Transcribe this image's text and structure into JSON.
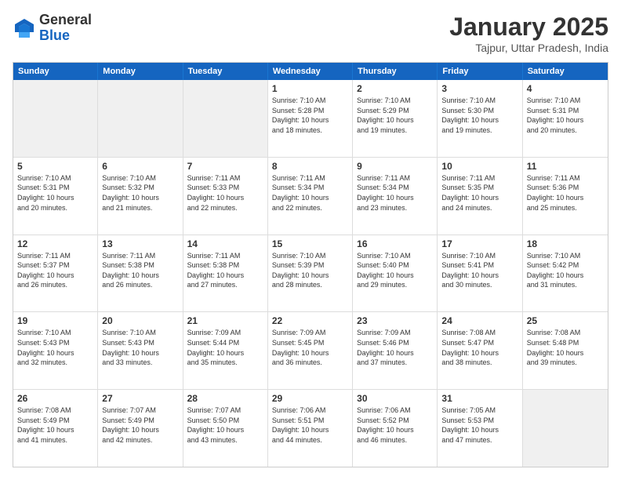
{
  "logo": {
    "general": "General",
    "blue": "Blue"
  },
  "title": "January 2025",
  "location": "Tajpur, Uttar Pradesh, India",
  "days_of_week": [
    "Sunday",
    "Monday",
    "Tuesday",
    "Wednesday",
    "Thursday",
    "Friday",
    "Saturday"
  ],
  "weeks": [
    [
      {
        "day": "",
        "info": ""
      },
      {
        "day": "",
        "info": ""
      },
      {
        "day": "",
        "info": ""
      },
      {
        "day": "1",
        "info": "Sunrise: 7:10 AM\nSunset: 5:28 PM\nDaylight: 10 hours\nand 18 minutes."
      },
      {
        "day": "2",
        "info": "Sunrise: 7:10 AM\nSunset: 5:29 PM\nDaylight: 10 hours\nand 19 minutes."
      },
      {
        "day": "3",
        "info": "Sunrise: 7:10 AM\nSunset: 5:30 PM\nDaylight: 10 hours\nand 19 minutes."
      },
      {
        "day": "4",
        "info": "Sunrise: 7:10 AM\nSunset: 5:31 PM\nDaylight: 10 hours\nand 20 minutes."
      }
    ],
    [
      {
        "day": "5",
        "info": "Sunrise: 7:10 AM\nSunset: 5:31 PM\nDaylight: 10 hours\nand 20 minutes."
      },
      {
        "day": "6",
        "info": "Sunrise: 7:10 AM\nSunset: 5:32 PM\nDaylight: 10 hours\nand 21 minutes."
      },
      {
        "day": "7",
        "info": "Sunrise: 7:11 AM\nSunset: 5:33 PM\nDaylight: 10 hours\nand 22 minutes."
      },
      {
        "day": "8",
        "info": "Sunrise: 7:11 AM\nSunset: 5:34 PM\nDaylight: 10 hours\nand 22 minutes."
      },
      {
        "day": "9",
        "info": "Sunrise: 7:11 AM\nSunset: 5:34 PM\nDaylight: 10 hours\nand 23 minutes."
      },
      {
        "day": "10",
        "info": "Sunrise: 7:11 AM\nSunset: 5:35 PM\nDaylight: 10 hours\nand 24 minutes."
      },
      {
        "day": "11",
        "info": "Sunrise: 7:11 AM\nSunset: 5:36 PM\nDaylight: 10 hours\nand 25 minutes."
      }
    ],
    [
      {
        "day": "12",
        "info": "Sunrise: 7:11 AM\nSunset: 5:37 PM\nDaylight: 10 hours\nand 26 minutes."
      },
      {
        "day": "13",
        "info": "Sunrise: 7:11 AM\nSunset: 5:38 PM\nDaylight: 10 hours\nand 26 minutes."
      },
      {
        "day": "14",
        "info": "Sunrise: 7:11 AM\nSunset: 5:38 PM\nDaylight: 10 hours\nand 27 minutes."
      },
      {
        "day": "15",
        "info": "Sunrise: 7:10 AM\nSunset: 5:39 PM\nDaylight: 10 hours\nand 28 minutes."
      },
      {
        "day": "16",
        "info": "Sunrise: 7:10 AM\nSunset: 5:40 PM\nDaylight: 10 hours\nand 29 minutes."
      },
      {
        "day": "17",
        "info": "Sunrise: 7:10 AM\nSunset: 5:41 PM\nDaylight: 10 hours\nand 30 minutes."
      },
      {
        "day": "18",
        "info": "Sunrise: 7:10 AM\nSunset: 5:42 PM\nDaylight: 10 hours\nand 31 minutes."
      }
    ],
    [
      {
        "day": "19",
        "info": "Sunrise: 7:10 AM\nSunset: 5:43 PM\nDaylight: 10 hours\nand 32 minutes."
      },
      {
        "day": "20",
        "info": "Sunrise: 7:10 AM\nSunset: 5:43 PM\nDaylight: 10 hours\nand 33 minutes."
      },
      {
        "day": "21",
        "info": "Sunrise: 7:09 AM\nSunset: 5:44 PM\nDaylight: 10 hours\nand 35 minutes."
      },
      {
        "day": "22",
        "info": "Sunrise: 7:09 AM\nSunset: 5:45 PM\nDaylight: 10 hours\nand 36 minutes."
      },
      {
        "day": "23",
        "info": "Sunrise: 7:09 AM\nSunset: 5:46 PM\nDaylight: 10 hours\nand 37 minutes."
      },
      {
        "day": "24",
        "info": "Sunrise: 7:08 AM\nSunset: 5:47 PM\nDaylight: 10 hours\nand 38 minutes."
      },
      {
        "day": "25",
        "info": "Sunrise: 7:08 AM\nSunset: 5:48 PM\nDaylight: 10 hours\nand 39 minutes."
      }
    ],
    [
      {
        "day": "26",
        "info": "Sunrise: 7:08 AM\nSunset: 5:49 PM\nDaylight: 10 hours\nand 41 minutes."
      },
      {
        "day": "27",
        "info": "Sunrise: 7:07 AM\nSunset: 5:49 PM\nDaylight: 10 hours\nand 42 minutes."
      },
      {
        "day": "28",
        "info": "Sunrise: 7:07 AM\nSunset: 5:50 PM\nDaylight: 10 hours\nand 43 minutes."
      },
      {
        "day": "29",
        "info": "Sunrise: 7:06 AM\nSunset: 5:51 PM\nDaylight: 10 hours\nand 44 minutes."
      },
      {
        "day": "30",
        "info": "Sunrise: 7:06 AM\nSunset: 5:52 PM\nDaylight: 10 hours\nand 46 minutes."
      },
      {
        "day": "31",
        "info": "Sunrise: 7:05 AM\nSunset: 5:53 PM\nDaylight: 10 hours\nand 47 minutes."
      },
      {
        "day": "",
        "info": ""
      }
    ]
  ]
}
